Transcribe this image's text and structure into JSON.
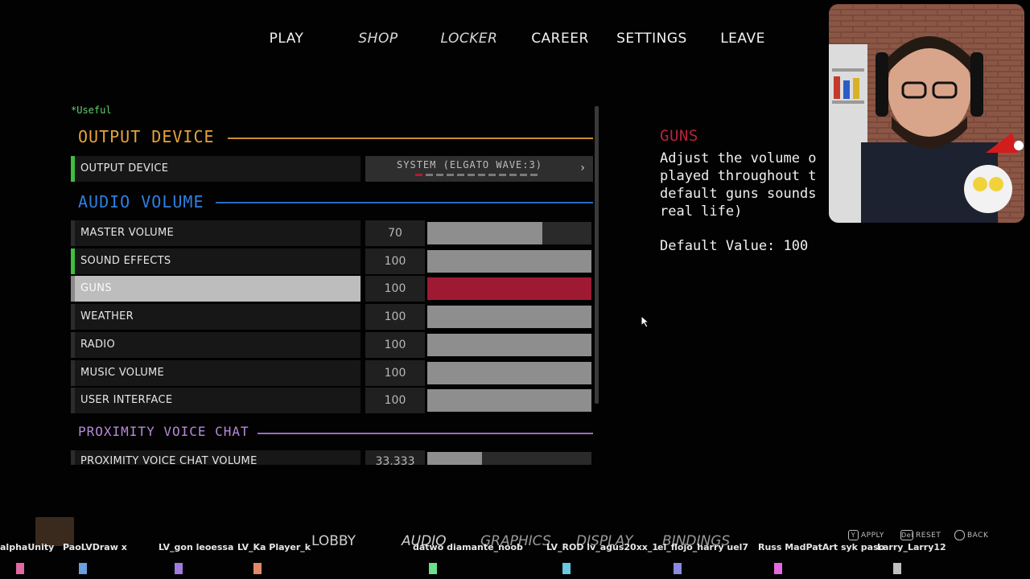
{
  "nav": {
    "play": "PLAY",
    "shop": "SHOP",
    "locker": "LOCKER",
    "career": "CAREER",
    "settings": "SETTINGS",
    "leave": "LEAVE"
  },
  "panel": {
    "useful_note": "*Useful",
    "output_section": "OUTPUT DEVICE",
    "output_device": {
      "label": "OUTPUT DEVICE",
      "value": "SYSTEM (ELGATO WAVE:3)",
      "page_index": 0,
      "page_count": 12
    },
    "audio_section": "AUDIO VOLUME",
    "rows": [
      {
        "label": "MASTER VOLUME",
        "value": "70",
        "level": 0.7
      },
      {
        "label": "SOUND EFFECTS",
        "value": "100",
        "level": 1.0
      },
      {
        "label": "GUNS",
        "value": "100",
        "level": 1.0
      },
      {
        "label": "WEATHER",
        "value": "100",
        "level": 1.0
      },
      {
        "label": "RADIO",
        "value": "100",
        "level": 1.0
      },
      {
        "label": "MUSIC VOLUME",
        "value": "100",
        "level": 1.0
      },
      {
        "label": "USER INTERFACE",
        "value": "100",
        "level": 1.0
      }
    ],
    "proximity_section": "PROXIMITY VOICE CHAT",
    "proximity_row": {
      "label": "PROXIMITY VOICE CHAT VOLUME",
      "value": "33.333",
      "level": 0.333
    }
  },
  "info": {
    "title": "GUNS",
    "description": "Adjust the volume o\nplayed throughout t\ndefault guns sounds\nreal life)",
    "default_value": "Default Value: 100"
  },
  "bottom": {
    "tabs": {
      "lobby": "LOBBY",
      "audio": "AUDIO",
      "graphics": "GRAPHICS",
      "display": "DISPLAY",
      "bindings": "BINDINGS"
    },
    "players": [
      "alphaUnity",
      "PaoLVDraw x",
      "LV_gon leoessa",
      "LV_Ka Player_k",
      "datwo diamante_noob",
      "LV_ROD lv_agus20xx_1",
      "el_flojo_harry uel7",
      "Russ MadPatArt syk paso",
      "Larry_Larry12"
    ],
    "hints": {
      "apply_key": "Y",
      "apply": "APPLY",
      "reset_key": "Del",
      "reset": "RESET",
      "back": "BACK"
    }
  },
  "colors": {
    "orange_section": "#e6a23c",
    "blue_section": "#2f7fe0",
    "purple_section": "#b88ad8",
    "selected_slider": "#9e1a33",
    "green_active": "#3fbf3f"
  }
}
